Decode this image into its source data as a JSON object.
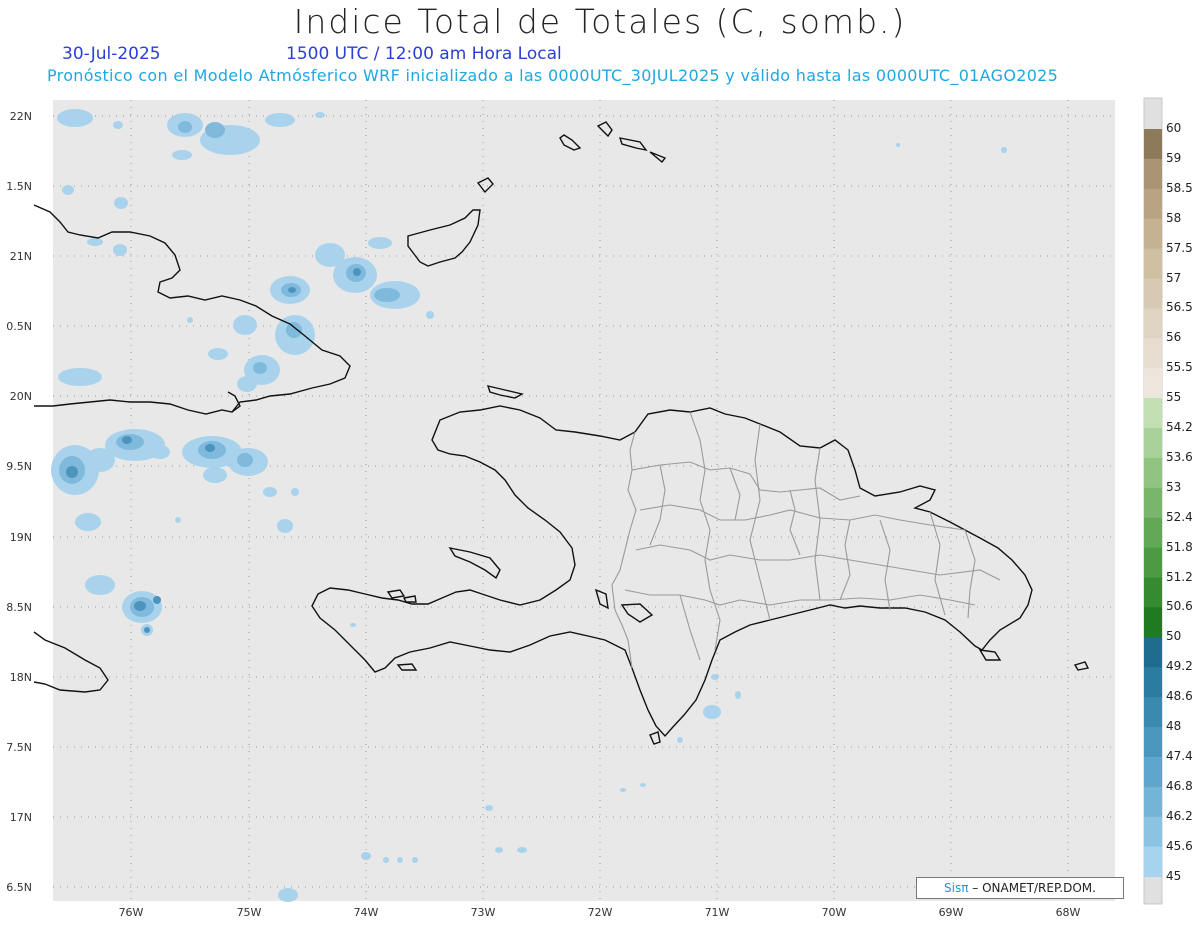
{
  "title": "Indice Total de Totales (C, somb.)",
  "date": "30-Jul-2025",
  "time": "1500 UTC / 12:00 am Hora Local",
  "subtitle": "Pronóstico con el Modelo Atmósferico WRF inicializado a las 0000UTC_30JUL2025 y válido hasta las  0000UTC_01AGO2025",
  "credit": {
    "logo": "Sisπ",
    "text": "– ONAMET/REP.DOM."
  },
  "lat_labels": [
    "22N",
    "1.5N",
    "21N",
    "0.5N",
    "20N",
    "9.5N",
    "19N",
    "8.5N",
    "18N",
    "7.5N",
    "17N",
    "6.5N"
  ],
  "lon_labels": [
    "76W",
    "75W",
    "74W",
    "73W",
    "72W",
    "71W",
    "70W",
    "69W",
    "68W"
  ],
  "colorbar": {
    "labels": [
      "60",
      "59",
      "58.5",
      "58",
      "57.5",
      "57",
      "56.5",
      "56",
      "55.5",
      "55",
      "54.2",
      "53.6",
      "53",
      "52.4",
      "51.8",
      "51.2",
      "50.6",
      "50",
      "49.2",
      "48.6",
      "48",
      "47.4",
      "46.8",
      "46.2",
      "45.6",
      "45"
    ],
    "colors": [
      "#8c7a5a",
      "#a99474",
      "#b8a482",
      "#c4b293",
      "#cfbfa3",
      "#d7c9b2",
      "#dfd4c2",
      "#e6ddd0",
      "#ece6dd",
      "#c3e0b4",
      "#a9d19a",
      "#91c482",
      "#79b66c",
      "#62a857",
      "#4c9a44",
      "#358b32",
      "#1f7a22",
      "#1e6d8e",
      "#2a7ca0",
      "#3a8ab0",
      "#4a97be",
      "#5ea6cb",
      "#74b4d7",
      "#8cc3e2",
      "#a6d3ed"
    ],
    "colors_meaning": "fill colors between successive labels, top to bottom"
  },
  "map_colors": {
    "background": "#e8e8e8",
    "coast": "#111111",
    "provinces": "#9a9a9a",
    "gridlines": "#999999"
  }
}
